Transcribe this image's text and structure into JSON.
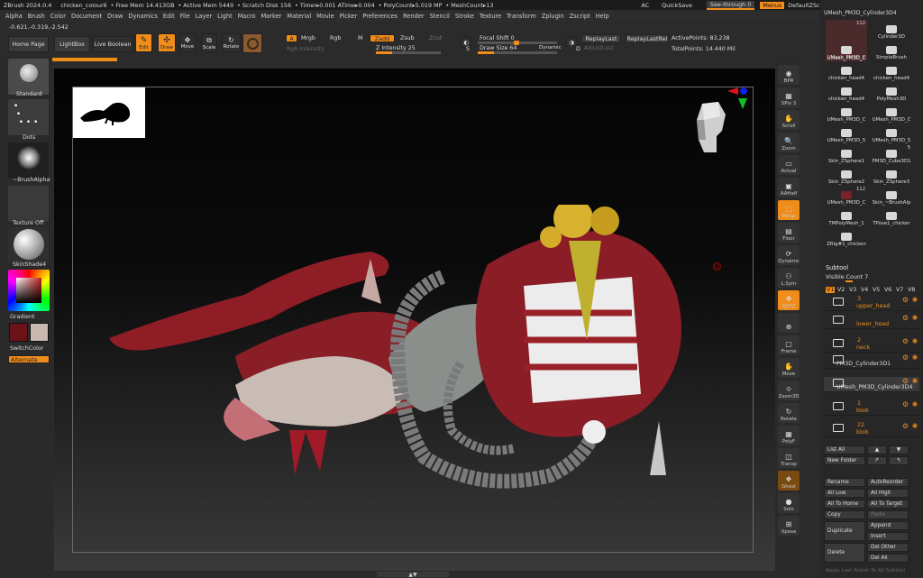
{
  "titlebar": {
    "app": "ZBrush 2024.0.4",
    "file": "chicken_colour6",
    "free_mem": "• Free Mem 14.413GB",
    "active_mem": "• Active Mem 5449",
    "scratch": "• Scratch Disk 156",
    "timer": "• Timer▸0.001 ATime▸0.004",
    "polycount": "• PolyCount▸5.019 MP",
    "meshcount": "• MeshCount▸13",
    "ac": "AC",
    "quicksave": "QuickSave",
    "see_through": "See-through",
    "see_through_value": "0",
    "menus": "Menus",
    "default_zscript": "DefaultZScript"
  },
  "menubar": [
    "Alpha",
    "Brush",
    "Color",
    "Document",
    "Draw",
    "Dynamics",
    "Edit",
    "File",
    "Layer",
    "Light",
    "Macro",
    "Marker",
    "Material",
    "Movie",
    "Picker",
    "Preferences",
    "Render",
    "Stencil",
    "Stroke",
    "Texture",
    "Transform",
    "Zplugin",
    "Zscript",
    "Help"
  ],
  "coords": "-0.621,-0.319,-2.542",
  "toolbar": {
    "home_page": "Home Page",
    "lightbox": "LightBox",
    "live_boolean": "Live Boolean",
    "edit": "Edit",
    "draw": "Draw",
    "move": "Move",
    "scale": "Scale",
    "rotate": "Rotate",
    "a": "A",
    "mrgb": "Mrgb",
    "rgb": "Rgb",
    "m": "M",
    "zadd": "Zadd",
    "zsub": "Zsub",
    "zcut": "Zcut",
    "rgb_intensity": "Rgb Intensity",
    "z_intensity": "Z Intensity 25",
    "focal_shift": "Focal Shift 0",
    "draw_size": "Draw Size 64",
    "dynamic": "Dynamic",
    "s": "S",
    "d": "D",
    "replay_last": "ReplayLast",
    "replay_last_rel": "ReplayLastRel",
    "adjust_last": "AdjustLast",
    "active_points": "ActivePoints: 83,238",
    "total_points": "TotalPoints: 14.440 Mil",
    "z_intensity_level": 0.25,
    "draw_size_level": 0.21
  },
  "leftshelf": {
    "standard": "Standard",
    "dots": "Dots",
    "brush_alpha": "~BrushAlpha",
    "texture_off": "Texture Off",
    "material": "SkinShade4",
    "gradient": "Gradient",
    "switch_color": "SwitchColor",
    "alternate": "Alternate",
    "main_color": "#6b1218",
    "secondary_color": "#c9b8b0"
  },
  "navrail": [
    "BPR",
    "SPix 3",
    "Scroll",
    "Zoom",
    "Actual",
    "AAHalf",
    "Persp",
    "Floor",
    "Dynamic",
    "L.Sym",
    "QXYZ",
    "",
    "Frame",
    "Move",
    "Zoom3D",
    "Rotate",
    "PolyF",
    "Transp",
    "Ghost",
    "Solo",
    "Xpose"
  ],
  "tools": {
    "current": "UMesh_PM3D_Cylinder3D4",
    "items": [
      {
        "label": "UMesh_PM3D_C",
        "badge": "112"
      },
      {
        "label": "Cylinder3D"
      },
      {
        "label": "UMesh_PM3D_C"
      },
      {
        "label": "SimpleBrush"
      },
      {
        "label": "chicken_head4"
      },
      {
        "label": "chicken_head4"
      },
      {
        "label": "chicken_head4"
      },
      {
        "label": "PolyMesh3D"
      },
      {
        "label": "UMesh_PM3D_C"
      },
      {
        "label": "UMesh_PM3D_C"
      },
      {
        "label": "UMesh_PM3D_S"
      },
      {
        "label": "UMesh_PM3D_S"
      },
      {
        "label": "Skin_ZSphere1"
      },
      {
        "label": "PM3D_Cube3D1",
        "badge": "5"
      },
      {
        "label": "Skin_ZSphere2"
      },
      {
        "label": "Skin_ZSphere3"
      },
      {
        "label": "UMesh_PM3D_C",
        "badge": "112"
      },
      {
        "label": "Skin_~BrushAlp"
      },
      {
        "label": "TMPolyMesh_1"
      },
      {
        "label": "TPose1_chicker"
      },
      {
        "label": "ZRig#1_chicken"
      }
    ]
  },
  "subtool": {
    "title": "Subtool",
    "visible_count": "Visible Count 7",
    "versions": [
      "V1",
      "V2",
      "V3",
      "V4",
      "V5",
      "V6",
      "V7",
      "V8"
    ],
    "rows": [
      {
        "num": "3",
        "name": "upper_head"
      },
      {
        "num": "",
        "name": "lower_head"
      },
      {
        "num": "2",
        "name": "neck"
      },
      {
        "num": "",
        "name": "PM3D_Cylinder3D1"
      },
      {
        "num": "",
        "name": "UMesh_PM3D_Cylinder3D4"
      },
      {
        "num": "1",
        "name": "blob"
      },
      {
        "num": "22",
        "name": "blob"
      }
    ]
  },
  "subtool_buttons": {
    "list_all": "List All",
    "new_folder": "New Folder",
    "rename": "Rename",
    "autoreorder": "AutoReorder",
    "all_low": "All Low",
    "all_high": "All High",
    "all_to_home": "All To Home",
    "all_to_target": "All To Target",
    "copy": "Copy",
    "paste": "Paste",
    "duplicate": "Duplicate",
    "append": "Append",
    "insert": "Insert",
    "delete": "Delete",
    "del_other": "Del Other",
    "del_all": "Del All",
    "apply_last": "Apply Last Action To All Subtool"
  }
}
